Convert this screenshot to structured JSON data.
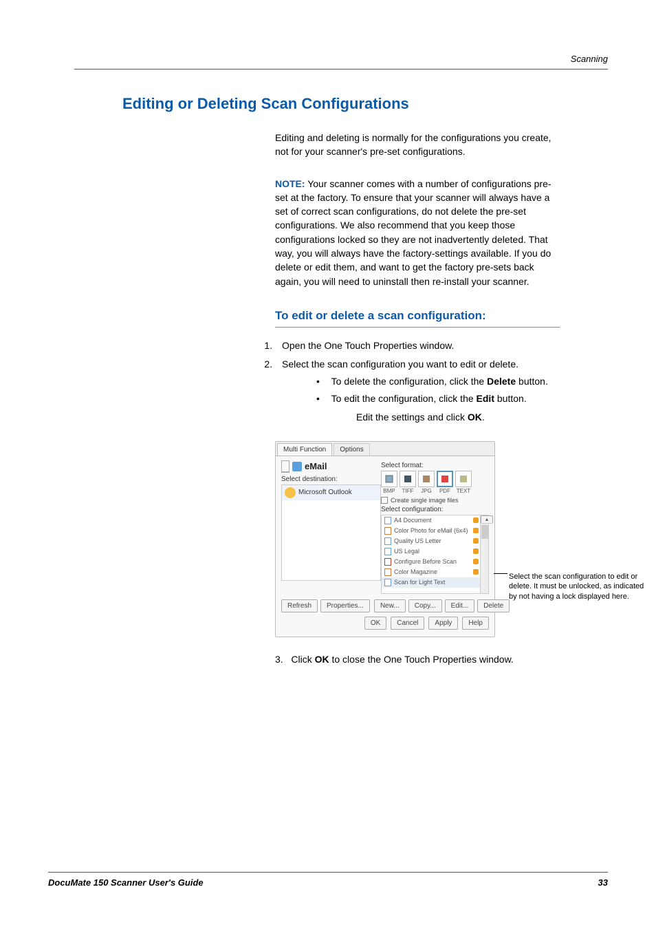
{
  "header": {
    "section": "Scanning"
  },
  "title": "Editing or Deleting Scan Configurations",
  "intro": "Editing and deleting is normally for the configurations you create, not for your scanner's pre-set configurations.",
  "note": {
    "label": "NOTE:",
    "text": "Your scanner comes with a number of configurations pre-set at the factory. To ensure that your scanner will always have a set of correct scan configurations, do not delete the pre-set configurations. We also recommend that you keep those configurations locked so they are not inadvertently deleted. That way, you will always have the factory-settings available. If you do delete or edit them, and want to get the factory pre-sets back again, you will need to uninstall then re-install your scanner."
  },
  "subheading": "To edit or delete a scan configuration:",
  "steps": {
    "s1": "Open the One Touch Properties window.",
    "s2": "Select the scan configuration you want to edit or delete.",
    "s2a_pre": "To delete the configuration, click the ",
    "s2a_bold": "Delete",
    "s2a_post": " button.",
    "s2b_pre": "To edit the configuration, click the ",
    "s2b_bold": "Edit",
    "s2b_post": " button.",
    "s2b2_pre": "Edit the settings and click ",
    "s2b2_bold": "OK",
    "s2b2_post": ".",
    "s3_pre": "Click ",
    "s3_bold": "OK",
    "s3_post": " to close the One Touch Properties window."
  },
  "dialog": {
    "tabs": {
      "t1": "Multi Function",
      "t2": "Options"
    },
    "email": "eMail",
    "select_dest": "Select destination:",
    "dest_item": "Microsoft Outlook",
    "select_format": "Select format:",
    "formats": {
      "f1": "BMP",
      "f2": "TIFF",
      "f3": "JPG",
      "f4": "PDF",
      "f5": "TEXT"
    },
    "create_single": "Create single image files",
    "select_config": "Select configuration:",
    "configs": {
      "c1": "A4 Document",
      "c2": "Color Photo for eMail (6x4)",
      "c3": "Quality US Letter",
      "c4": "US Legal",
      "c5": "Configure Before Scan",
      "c6": "Color Magazine",
      "c7": "Scan for Light Text"
    },
    "buttons": {
      "refresh": "Refresh",
      "properties": "Properties...",
      "new": "New...",
      "copy": "Copy...",
      "edit": "Edit...",
      "delete": "Delete",
      "ok": "OK",
      "cancel": "Cancel",
      "apply": "Apply",
      "help": "Help"
    }
  },
  "callout": "Select the scan configuration to edit or delete. It must be unlocked, as indicated by not having a lock displayed here.",
  "footer": {
    "left": "DocuMate 150 Scanner User's Guide",
    "right": "33"
  }
}
